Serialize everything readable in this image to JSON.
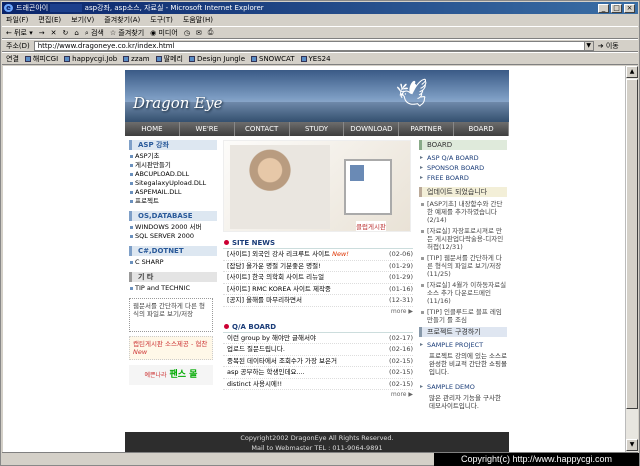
{
  "window": {
    "title_prefix": "드래곤아이",
    "title_main": "asp강좌, asp소스, 자료실",
    "title_suffix": "- Microsoft Internet Explorer"
  },
  "menu": [
    "파일(F)",
    "편집(E)",
    "보기(V)",
    "즐겨찾기(A)",
    "도구(T)",
    "도움말(H)"
  ],
  "toolbar": {
    "back": "뒤로",
    "search": "검색",
    "favorites": "즐겨찾기",
    "media": "미디어"
  },
  "address": {
    "label": "주소(D)",
    "url": "http://www.dragoneye.co.kr/index.html",
    "go": "이동"
  },
  "links": {
    "label": "연결",
    "items": [
      "해피CGI",
      "happycgi.Job",
      "zzam",
      "딸메리",
      "Design Jungle",
      "SNOWCAT",
      "YES24"
    ]
  },
  "site": {
    "logo": "Dragon Eye",
    "nav": [
      "HOME",
      "WE'RE",
      "CONTACT",
      "STUDY",
      "DOWNLOAD",
      "PARTNER",
      "BOARD"
    ],
    "left": {
      "sections": [
        {
          "title": "ASP 강좌",
          "items": [
            "ASP기초",
            "게시판만들기",
            "ABCUPLOAD.DLL",
            "SitegalaxyUpload.DLL",
            "ASPEMAIL.DLL",
            "프로젝트"
          ]
        },
        {
          "title": "OS,DATABASE",
          "items": [
            "WINDOWS 2000 서버",
            "SQL SERVER 2000"
          ]
        },
        {
          "title": "C#,DOTNET",
          "items": [
            "C SHARP"
          ]
        },
        {
          "title": "기 타",
          "items": [
            "TIP and TECHNIC"
          ]
        }
      ],
      "box1": "웹문서를 간단하게 다른 형식의 파일로 보기/저장",
      "box2": "캡틴게시판 소스제공 - 협찬",
      "box2_new": "New",
      "ad_small": "예쁜나라",
      "ad_big": "팬스 몰"
    },
    "hero_caption": "클럽게시판",
    "site_news": {
      "title": "SITE NEWS",
      "items": [
        {
          "text": "[사이트] 외국인 강사 리크루트 사이트",
          "new": "New!",
          "date": "(02-06)"
        },
        {
          "text": "[잡담] 올가운 명절 기분좋은 명절!",
          "new": "",
          "date": "(01-29)"
        },
        {
          "text": "[사이트] 한국 의학회 사이트 리뉴얼",
          "new": "",
          "date": "(01-29)"
        },
        {
          "text": "[사이트] RMC KOREA 사이트 제작중",
          "new": "",
          "date": "(01-16)"
        },
        {
          "text": "[공지] 올해를 마무리하면서",
          "new": "",
          "date": "(12-31)"
        }
      ],
      "more": "more ▶"
    },
    "qa_board": {
      "title": "Q/A BOARD",
      "items": [
        {
          "text": "이런 group by 해야만 글해서야",
          "date": "(02-17)"
        },
        {
          "text": "업로드 질문드립니다.",
          "date": "(02-16)"
        },
        {
          "text": "중복된 데이타에서 조회수가 가장 보은거",
          "date": "(02-15)"
        },
        {
          "text": "asp 공부하는 학생인데요....",
          "date": "(02-15)"
        },
        {
          "text": "distinct 사용시에!!",
          "date": "(02-15)"
        }
      ],
      "more": "more ▶"
    },
    "right": {
      "board_title": "BOARD",
      "board_items": [
        "ASP Q/A BOARD",
        "SPONSOR BOARD",
        "FREE BOARD"
      ],
      "update_title": "업데이트 되었습니다",
      "updates": [
        "[ASP기초] 내장함수와 간단한 예제를 추가하였습니다(2/14)",
        "[자료실] 자장포로시져로 만든 게시판업다락술용-디자인허접(12/31)",
        "[TIP] 웹문서를 간단하게 다른 형식의 파일로 보기/저장(11/25)",
        "[자료실] 4월가 이하동자료실 소스 추가 다운로드메인(11/16)",
        "[TIP] 인클루드로 블프 레임만들기 를 조심"
      ],
      "project_title": "프로젝트 구경하기",
      "projects": [
        {
          "name": "SAMPLE PROJECT",
          "desc": "프로젝트 강의에 있는 소스로 완성한 비교적 간단한 쇼핑몰입니다."
        },
        {
          "name": "SAMPLE DEMO",
          "desc": "많은 관리자 기능을 구사한 데모사이트입니다."
        }
      ]
    },
    "footer": {
      "line1": "Copyright2002 DragonEye All Rights Reserved.",
      "line2": "Mail to Webmaster TEL : 011-9064-9891"
    }
  },
  "watermark": "Copyright(c) http://www.happycgi.com"
}
